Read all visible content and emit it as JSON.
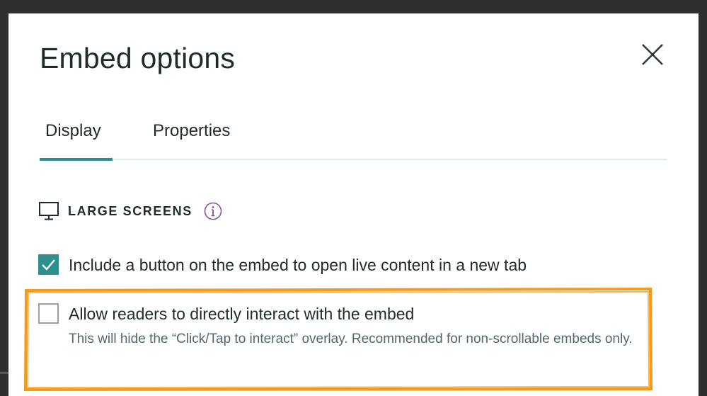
{
  "dialog": {
    "title": "Embed options",
    "close_icon": "close-icon"
  },
  "tabs": [
    {
      "label": "Display",
      "active": true
    },
    {
      "label": "Properties",
      "active": false
    }
  ],
  "section": {
    "icon": "monitor-icon",
    "title": "LARGE SCREENS",
    "info_icon": "info-icon"
  },
  "options": [
    {
      "label": "Include a button on the embed to open live content in a new tab",
      "checked": true
    },
    {
      "label": "Allow readers to directly interact with the embed",
      "helper": "This will hide the “Click/Tap to interact” overlay. Recommended for non-scrollable embeds only.",
      "checked": false
    }
  ],
  "colors": {
    "accent": "#2f8f8f",
    "highlight": "#f59a1a",
    "text": "#1f2b2b",
    "info_purple": "#8a4fa0"
  }
}
